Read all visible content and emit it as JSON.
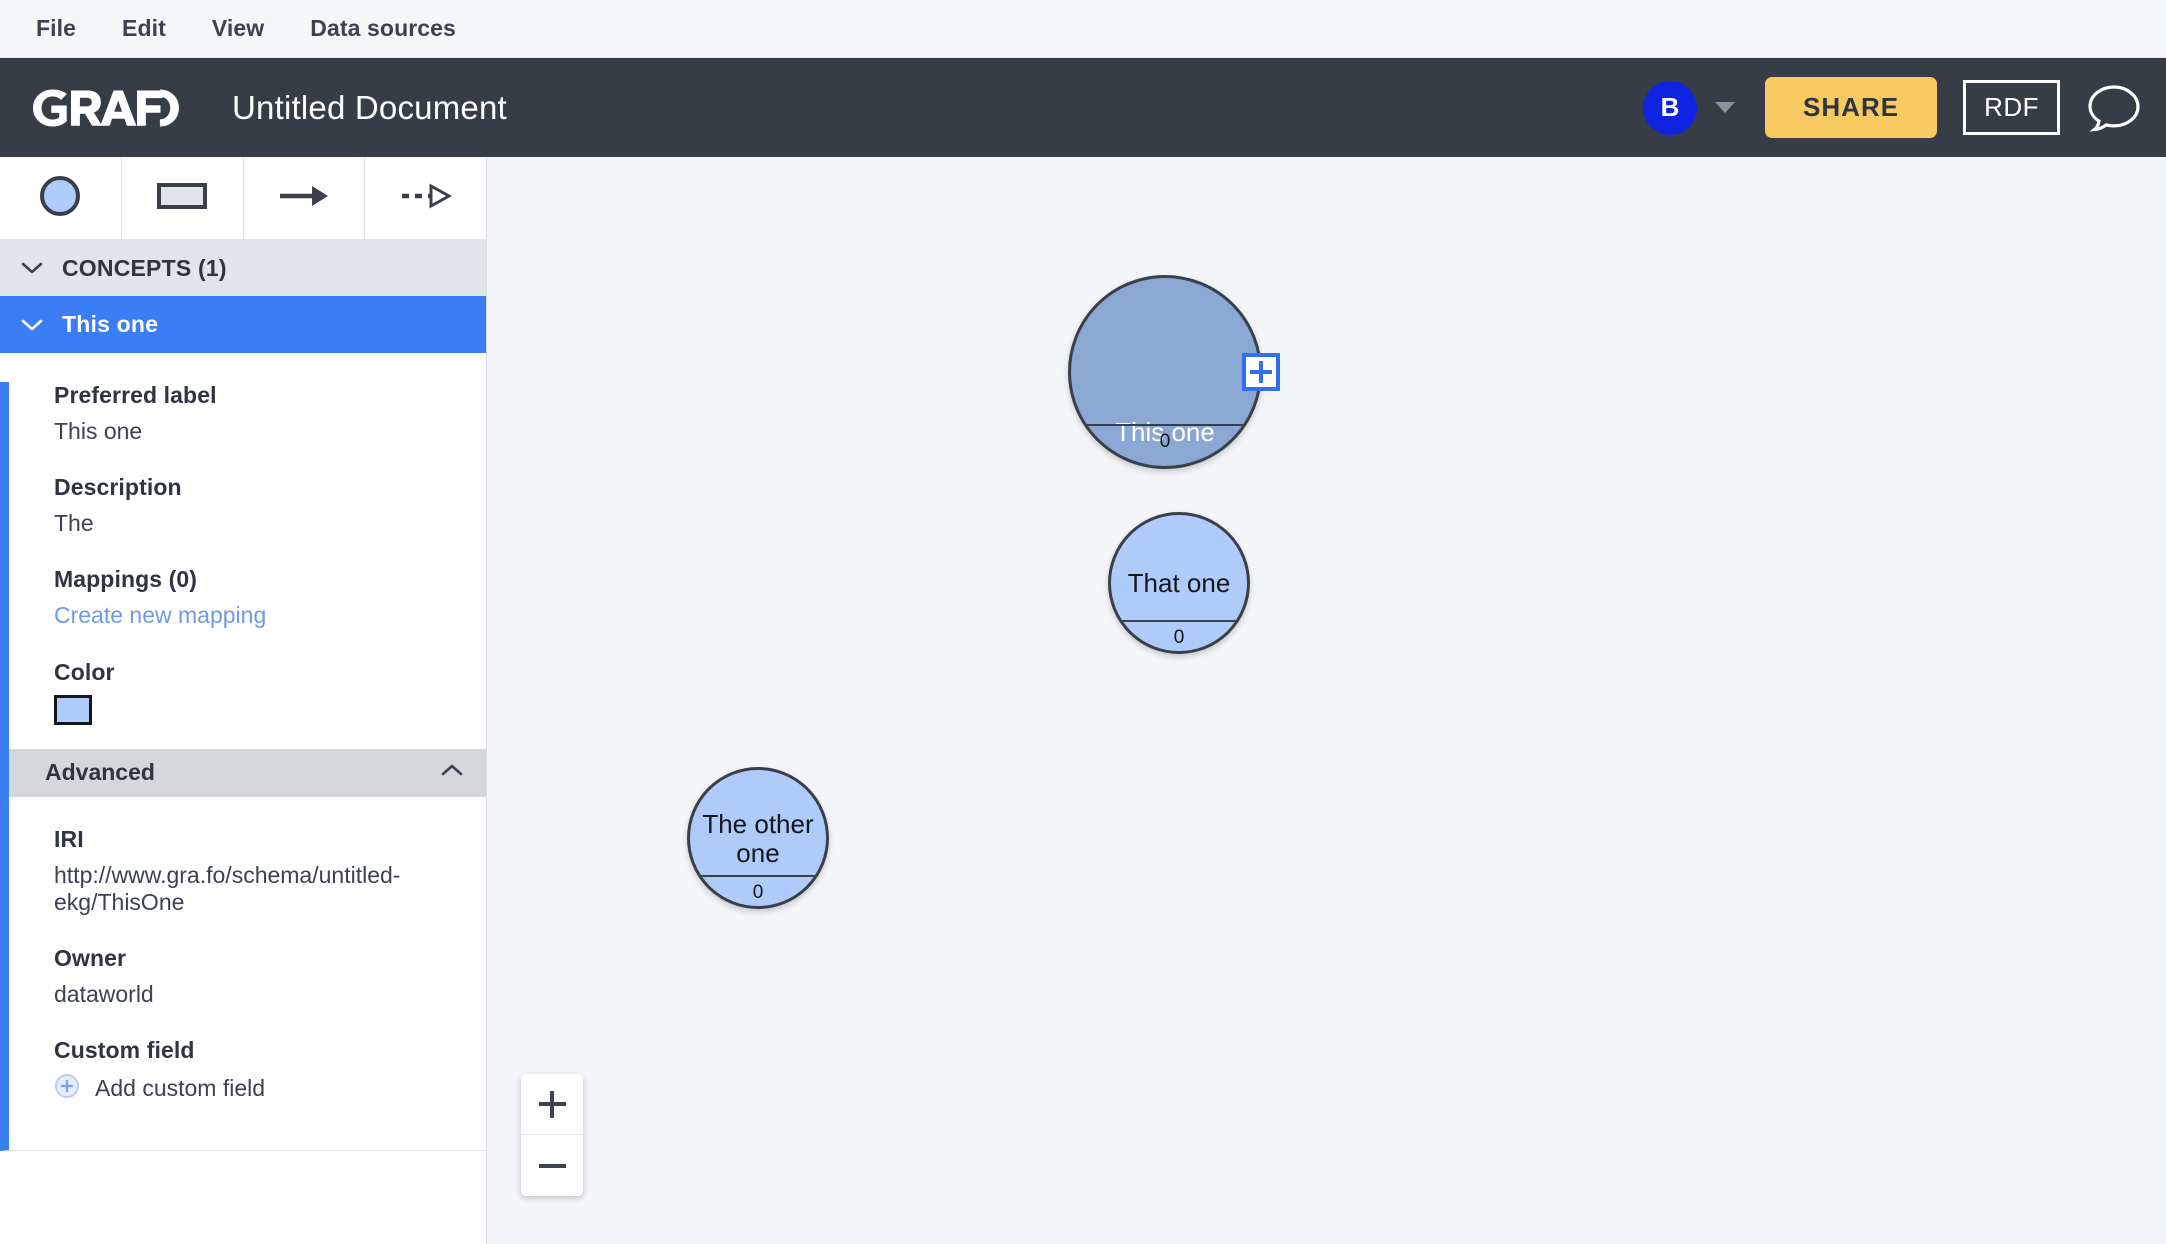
{
  "menubar": {
    "items": [
      {
        "label": "File"
      },
      {
        "label": "Edit"
      },
      {
        "label": "View"
      },
      {
        "label": "Data sources"
      }
    ]
  },
  "header": {
    "logo_text": "GRAFO",
    "document_title": "Untitled Document",
    "avatar_initial": "B",
    "share_label": "SHARE",
    "rdf_label": "RDF",
    "comment_icon": "speech-bubble-icon",
    "caret_icon": "chevron-down-icon",
    "background_color": "#373d47",
    "share_color": "#f7ca61",
    "avatar_color": "#0f23e0"
  },
  "toolbar": {
    "tools": [
      {
        "name": "concept-circle-tool",
        "icon": "circle-icon"
      },
      {
        "name": "datatype-rectangle-tool",
        "icon": "rectangle-icon"
      },
      {
        "name": "relationship-arrow-tool",
        "icon": "solid-arrow-icon"
      },
      {
        "name": "subclass-arrow-tool",
        "icon": "dashed-arrow-icon"
      }
    ]
  },
  "sidebar": {
    "section": {
      "title": "CONCEPTS (1)",
      "expanded": true
    },
    "concept": {
      "label": "This one",
      "expanded": true,
      "selected": true
    },
    "details": {
      "preferred_label_title": "Preferred label",
      "preferred_label_value": "This one",
      "description_title": "Description",
      "description_value": "The",
      "mappings_title": "Mappings (0)",
      "mappings_link": "Create new mapping",
      "color_title": "Color",
      "color_value": "#aecbfa",
      "advanced_title": "Advanced",
      "advanced_expanded": true,
      "iri_title": "IRI",
      "iri_value": "http://www.gra.fo/schema/untitled-ekg/ThisOne",
      "owner_title": "Owner",
      "owner_value": "dataworld",
      "custom_field_title": "Custom field",
      "add_custom_field_label": "Add custom field"
    }
  },
  "canvas": {
    "background_color": "#f3f5f8",
    "nodes": [
      {
        "label": "This one",
        "count": "0",
        "selected": true,
        "color": "#8ba7d4",
        "has_handle": true
      },
      {
        "label": "That one",
        "count": "0",
        "selected": false,
        "color": "#aecbfa",
        "has_handle": false
      },
      {
        "label": "The other one",
        "count": "0",
        "selected": false,
        "color": "#aecbfa",
        "has_handle": false
      }
    ],
    "zoom_in_label": "+",
    "zoom_out_label": "−"
  }
}
